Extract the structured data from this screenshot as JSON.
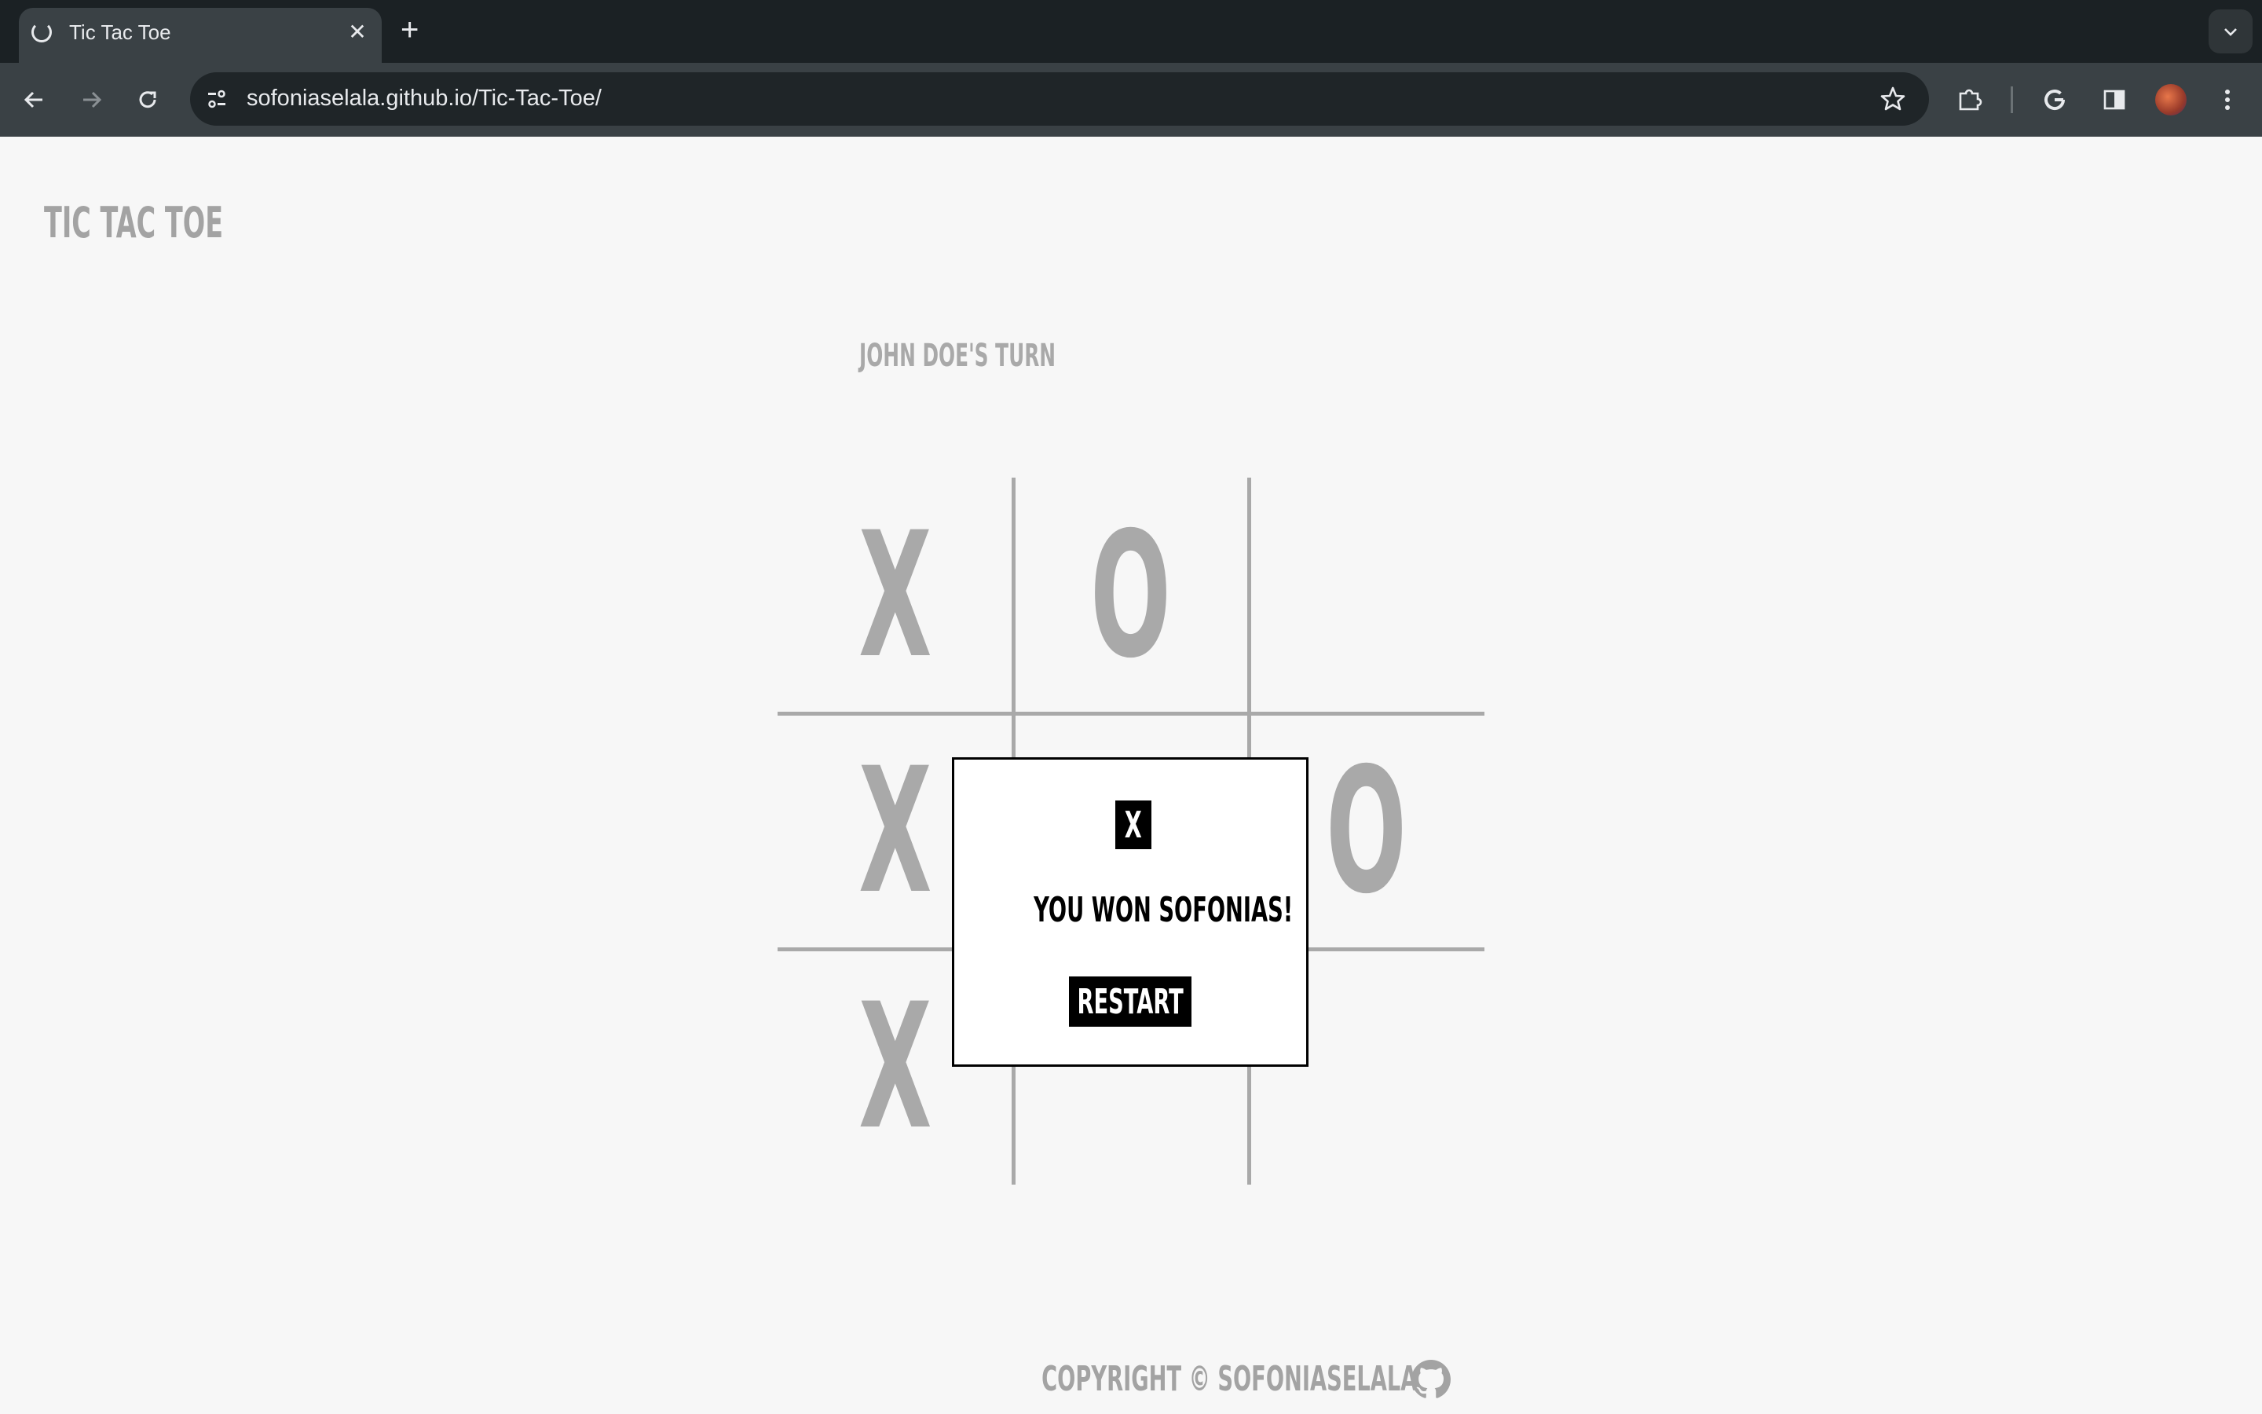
{
  "browser": {
    "tab_title": "Tic Tac Toe",
    "new_tab_symbol": "+",
    "close_symbol": "✕",
    "url": "sofoniaselala.github.io/Tic-Tac-Toe/"
  },
  "page": {
    "title": "TIC TAC TOE",
    "turn_text": "JOHN DOE'S TURN"
  },
  "board": {
    "cells": [
      "X",
      "O",
      "",
      "X",
      "",
      "O",
      "X",
      "",
      ""
    ]
  },
  "modal": {
    "close_label": "X",
    "message": "YOU WON SOFONIAS!",
    "restart_label": "RESTART"
  },
  "footer": {
    "text": "COPYRIGHT © SOFONIASELALA"
  },
  "colors": {
    "chrome_dark": "#1b2124",
    "toolbar": "#3a4145",
    "page_bg": "#f7f7f7",
    "mark_gray": "#a9a9a9",
    "modal_black": "#000000"
  }
}
